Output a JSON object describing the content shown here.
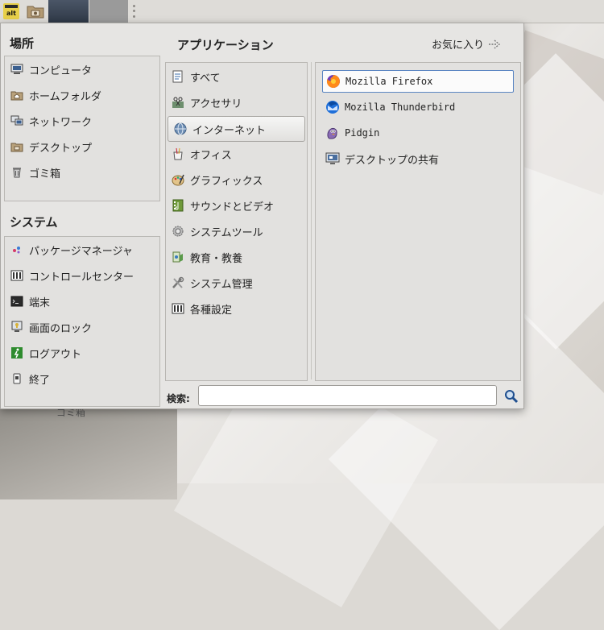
{
  "panel": {
    "menu_button_icon": "distro-menu-icon",
    "file_manager_icon": "folder-camera-icon"
  },
  "desktop": {
    "trash_label": "ゴミ箱"
  },
  "places": {
    "title": "場所",
    "items": [
      {
        "label": "コンピュータ",
        "icon": "computer-icon"
      },
      {
        "label": "ホームフォルダ",
        "icon": "home-folder-icon"
      },
      {
        "label": "ネットワーク",
        "icon": "network-icon"
      },
      {
        "label": "デスクトップ",
        "icon": "desktop-folder-icon"
      },
      {
        "label": "ゴミ箱",
        "icon": "trash-icon"
      }
    ]
  },
  "system": {
    "title": "システム",
    "items": [
      {
        "label": "パッケージマネージャ",
        "icon": "package-manager-icon"
      },
      {
        "label": "コントロールセンター",
        "icon": "control-center-icon"
      },
      {
        "label": "端末",
        "icon": "terminal-icon"
      },
      {
        "label": "画面のロック",
        "icon": "lock-screen-icon"
      },
      {
        "label": "ログアウト",
        "icon": "logout-icon"
      },
      {
        "label": "終了",
        "icon": "shutdown-icon"
      }
    ]
  },
  "applications": {
    "title": "アプリケーション",
    "favorites_label": "お気に入り",
    "categories": [
      {
        "label": "すべて",
        "icon": "all-apps-icon"
      },
      {
        "label": "アクセサリ",
        "icon": "accessories-icon"
      },
      {
        "label": "インターネット",
        "icon": "internet-globe-icon",
        "selected": true
      },
      {
        "label": "オフィス",
        "icon": "office-icon"
      },
      {
        "label": "グラフィックス",
        "icon": "graphics-palette-icon"
      },
      {
        "label": "サウンドとビデオ",
        "icon": "sound-video-icon"
      },
      {
        "label": "システムツール",
        "icon": "system-tools-icon"
      },
      {
        "label": "教育・教養",
        "icon": "education-icon"
      },
      {
        "label": "システム管理",
        "icon": "system-admin-icon"
      },
      {
        "label": "各種設定",
        "icon": "settings-icon"
      }
    ],
    "apps": [
      {
        "label": "Mozilla Firefox",
        "icon": "firefox-icon",
        "selected": true
      },
      {
        "label": "Mozilla Thunderbird",
        "icon": "thunderbird-icon"
      },
      {
        "label": "Pidgin",
        "icon": "pidgin-icon"
      },
      {
        "label": "デスクトップの共有",
        "icon": "desktop-sharing-icon"
      }
    ]
  },
  "search": {
    "label": "検索:",
    "value": "",
    "placeholder": ""
  }
}
